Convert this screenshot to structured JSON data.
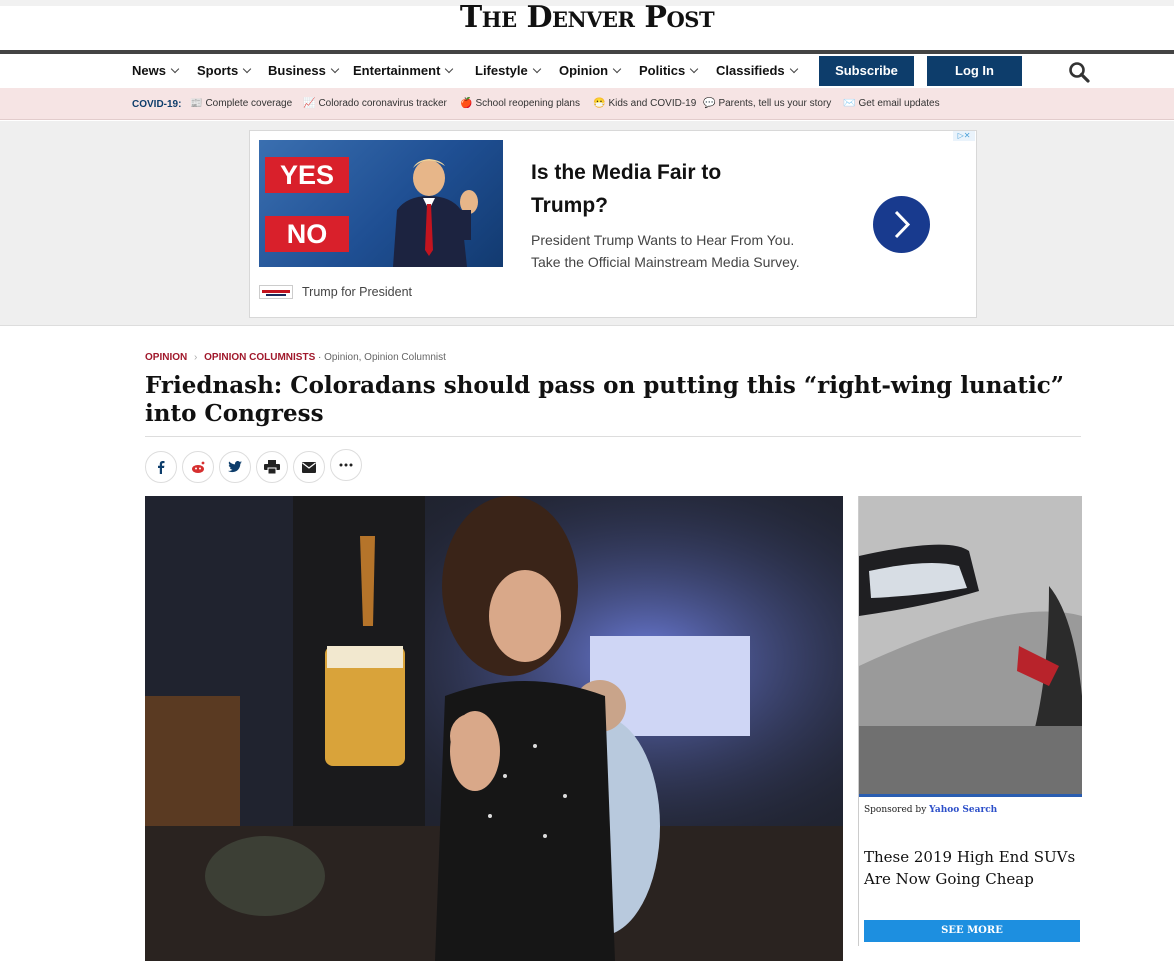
{
  "masthead": {
    "logo": "The Denver Post"
  },
  "nav": {
    "items": [
      {
        "label": "News"
      },
      {
        "label": "Sports"
      },
      {
        "label": "Business"
      },
      {
        "label": "Entertainment"
      },
      {
        "label": "Lifestyle"
      },
      {
        "label": "Opinion"
      },
      {
        "label": "Politics"
      },
      {
        "label": "Classifieds"
      }
    ],
    "subscribe_label": "Subscribe",
    "login_label": "Log In",
    "accent": "#0d3d6b"
  },
  "covid": {
    "label": "COVID-19:",
    "links": [
      {
        "icon": "📰",
        "label": "Complete coverage"
      },
      {
        "icon": "📈",
        "label": "Colorado coronavirus tracker"
      },
      {
        "icon": "🍎",
        "label": "School reopening plans"
      },
      {
        "icon": "😷",
        "label": "Kids and COVID-19"
      },
      {
        "icon": "💬",
        "label": "Parents, tell us your story"
      },
      {
        "icon": "✉️",
        "label": "Get email updates"
      }
    ]
  },
  "ad": {
    "yes": "YES",
    "no": "NO",
    "title": "Is the Media Fair to Trump?",
    "description": "President Trump Wants to Hear From You. Take the Official Mainstream Media Survey.",
    "sponsor": "Trump for President"
  },
  "article": {
    "section": "OPINION",
    "subsection": "OPINION COLUMNISTS",
    "meta": "Opinion, Opinion Columnist",
    "headline": "Friednash: Coloradans should pass on putting this “right-wing lunatic” into Congress"
  },
  "share": {
    "icons": [
      "facebook-icon",
      "reddit-icon",
      "twitter-icon",
      "print-icon",
      "email-icon",
      "more-icon"
    ]
  },
  "side_ad": {
    "sponsored_by": "Sponsored by",
    "sponsor": "Yahoo Search",
    "title": "These 2019 High End SUVs Are Now Going Cheap",
    "button": "SEE MORE"
  }
}
